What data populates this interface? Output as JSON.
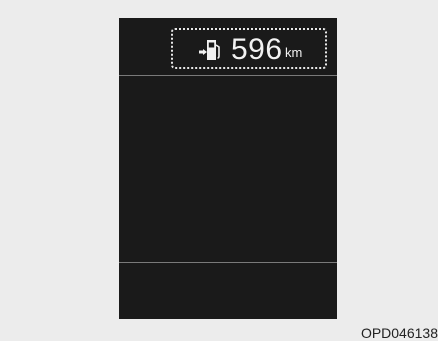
{
  "display": {
    "fuel_range": {
      "icon": "fuel-pump-icon",
      "arrow_icon": "fuel-door-side-arrow-icon",
      "value": "596",
      "unit": "km"
    }
  },
  "figure_code": "OPD046138"
}
